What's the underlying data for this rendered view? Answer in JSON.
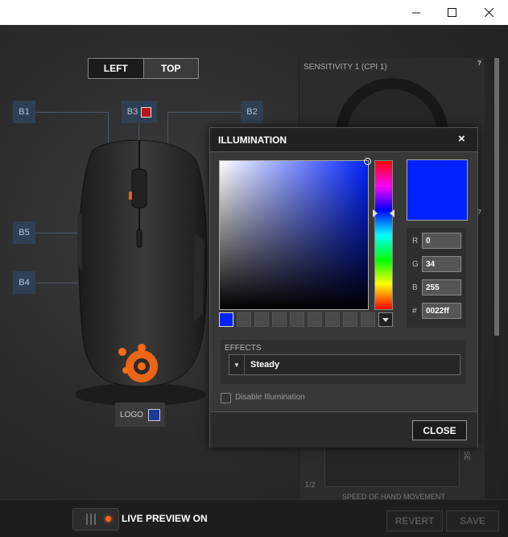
{
  "window": {
    "minimize_icon": "minimize-icon",
    "maximize_icon": "maximize-icon",
    "close_icon": "close-icon"
  },
  "view_toggle": {
    "left": "LEFT",
    "top": "TOP",
    "selected": "LEFT"
  },
  "buttons": {
    "b1": "B1",
    "b2": "B2",
    "b3": "B3",
    "b4": "B4",
    "b5": "B5",
    "logo": "LOGO"
  },
  "button_colors": {
    "b3": "#b3181a",
    "logo": "#1c3b9b"
  },
  "sensitivity": {
    "title": "SENSITIVITY 1 (CPI 1)",
    "help": "?",
    "page": "1/2",
    "graph_xlabel": "SPEED OF HAND MOVEMENT",
    "graph_ylabel": "SE"
  },
  "illumination": {
    "title": "ILLUMINATION",
    "close_x": "×",
    "color": "#0022ff",
    "rgb": {
      "r_label": "R",
      "r": "0",
      "g_label": "G",
      "g": "34",
      "b_label": "B",
      "b": "255",
      "hex_label": "#",
      "hex": "0022ff"
    },
    "swatches": [
      "#0022ff",
      "",
      "",
      "",
      "",
      "",
      "",
      "",
      "",
      ""
    ],
    "effects_label": "EFFECTS",
    "effect": "Steady",
    "disable_label": "Disable Illumination",
    "close_button": "CLOSE"
  },
  "bottom": {
    "live_preview": "LIVE PREVIEW ON",
    "revert": "REVERT",
    "save": "SAVE"
  }
}
